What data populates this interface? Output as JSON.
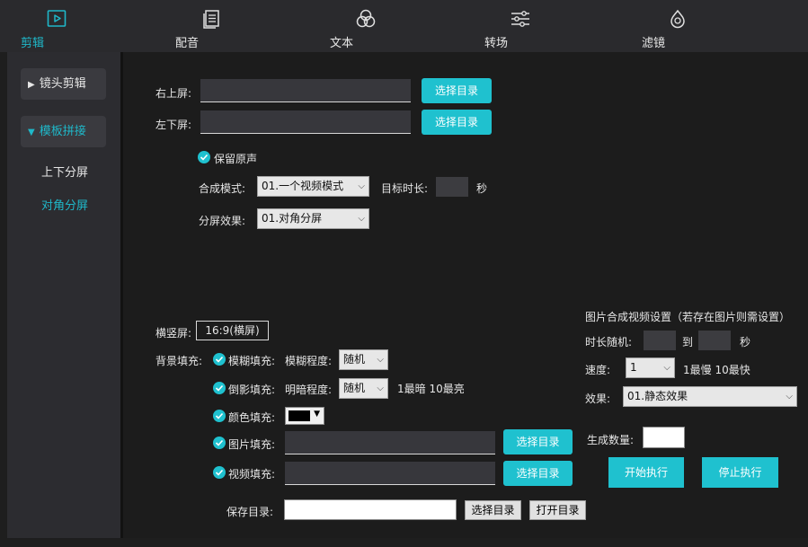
{
  "nav": [
    {
      "label": "剪辑",
      "icon": "play-square-icon"
    },
    {
      "label": "配音",
      "icon": "document-icon"
    },
    {
      "label": "文本",
      "icon": "circles-icon"
    },
    {
      "label": "转场",
      "icon": "sliders-icon"
    },
    {
      "label": "滤镜",
      "icon": "filter-drop-icon"
    }
  ],
  "sidebar": {
    "groups": [
      {
        "label": "镜头剪辑"
      },
      {
        "label": "模板拼接"
      }
    ],
    "sub_items": [
      {
        "label": "上下分屏"
      },
      {
        "label": "对角分屏"
      }
    ]
  },
  "form": {
    "top_right_label": "右上屏:",
    "bottom_left_label": "左下屏:",
    "choose_dir": "选择目录",
    "keep_audio": "保留原声",
    "compose_mode_label": "合成模式:",
    "compose_mode_value": "01.一个视频模式",
    "target_duration_label": "目标时长:",
    "seconds": "秒",
    "split_effect_label": "分屏效果:",
    "split_effect_value": "01.对角分屏",
    "orientation_label": "横竖屏:",
    "orientation_value": "16:9(横屏)",
    "bg_fill_label": "背景填充:",
    "blur_fill": "模糊填充:",
    "blur_degree_label": "模糊程度:",
    "blur_degree_value": "随机",
    "shadow_fill": "倒影填充:",
    "brightness_label": "明暗程度:",
    "brightness_value": "随机",
    "brightness_hint": "1最暗 10最亮",
    "color_fill": "颜色填充:",
    "color_value": "#000000",
    "image_fill": "图片填充:",
    "video_fill": "视频填充:",
    "save_dir_label": "保存目录:",
    "open_dir": "打开目录"
  },
  "image_settings": {
    "title": "图片合成视频设置（若存在图片则需设置）",
    "duration_random_label": "时长随机:",
    "to": "到",
    "seconds": "秒",
    "speed_label": "速度:",
    "speed_value": "1",
    "speed_hint": "1最慢 10最快",
    "effect_label": "效果:",
    "effect_value": "01.静态效果",
    "count_label": "生成数量:",
    "start_button": "开始执行",
    "stop_button": "停止执行"
  }
}
